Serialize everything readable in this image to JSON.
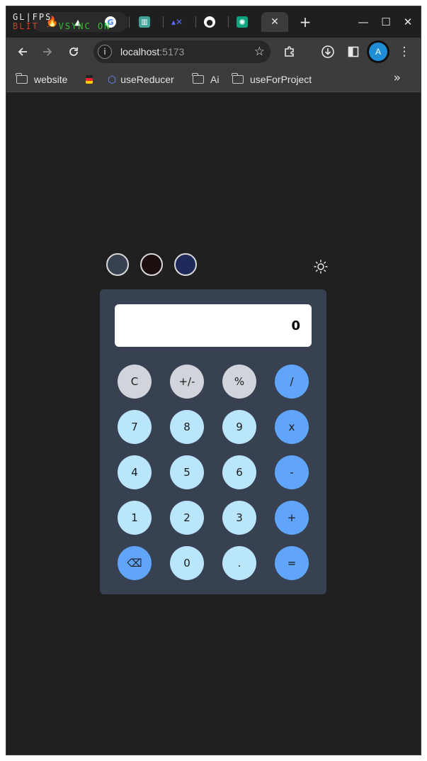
{
  "browser": {
    "fps_overlay": {
      "line1": "GL|FPS",
      "line2_a": "BLIT",
      "line2_sep": " - ",
      "line2_b": "VSYNC ON"
    },
    "active_tab_close": "✕",
    "new_tab": "+",
    "window_controls": {
      "minimize": "—",
      "maximize": "☐",
      "close": "✕"
    },
    "address": {
      "host": "localhost",
      "port": ":5173"
    },
    "profile_initial": "A",
    "bookmarks": [
      {
        "label": "website"
      },
      {
        "label": "useReducer"
      },
      {
        "label": "Ai"
      },
      {
        "label": "useForProject"
      }
    ],
    "bookmarks_more": "»"
  },
  "app": {
    "theme_swatches": [
      {
        "color": "#374151"
      },
      {
        "color": "#1c0e0e"
      },
      {
        "color": "#1e2a5a"
      }
    ],
    "display_value": "0",
    "keys": [
      {
        "label": "C",
        "kind": "fn"
      },
      {
        "label": "+/-",
        "kind": "fn"
      },
      {
        "label": "%",
        "kind": "fn"
      },
      {
        "label": "/",
        "kind": "op"
      },
      {
        "label": "7",
        "kind": "num"
      },
      {
        "label": "8",
        "kind": "num"
      },
      {
        "label": "9",
        "kind": "num"
      },
      {
        "label": "x",
        "kind": "op"
      },
      {
        "label": "4",
        "kind": "num"
      },
      {
        "label": "5",
        "kind": "num"
      },
      {
        "label": "6",
        "kind": "num"
      },
      {
        "label": "-",
        "kind": "op"
      },
      {
        "label": "1",
        "kind": "num"
      },
      {
        "label": "2",
        "kind": "num"
      },
      {
        "label": "3",
        "kind": "num"
      },
      {
        "label": "+",
        "kind": "op"
      },
      {
        "label": "⌫",
        "kind": "op"
      },
      {
        "label": "0",
        "kind": "num"
      },
      {
        "label": ".",
        "kind": "num"
      },
      {
        "label": "=",
        "kind": "op"
      }
    ]
  },
  "colors": {
    "page_bg": "#212020",
    "calc_bg": "#374151",
    "key_fn": "#d1d5db",
    "key_num": "#bae6fd",
    "key_op": "#60a5fa"
  }
}
